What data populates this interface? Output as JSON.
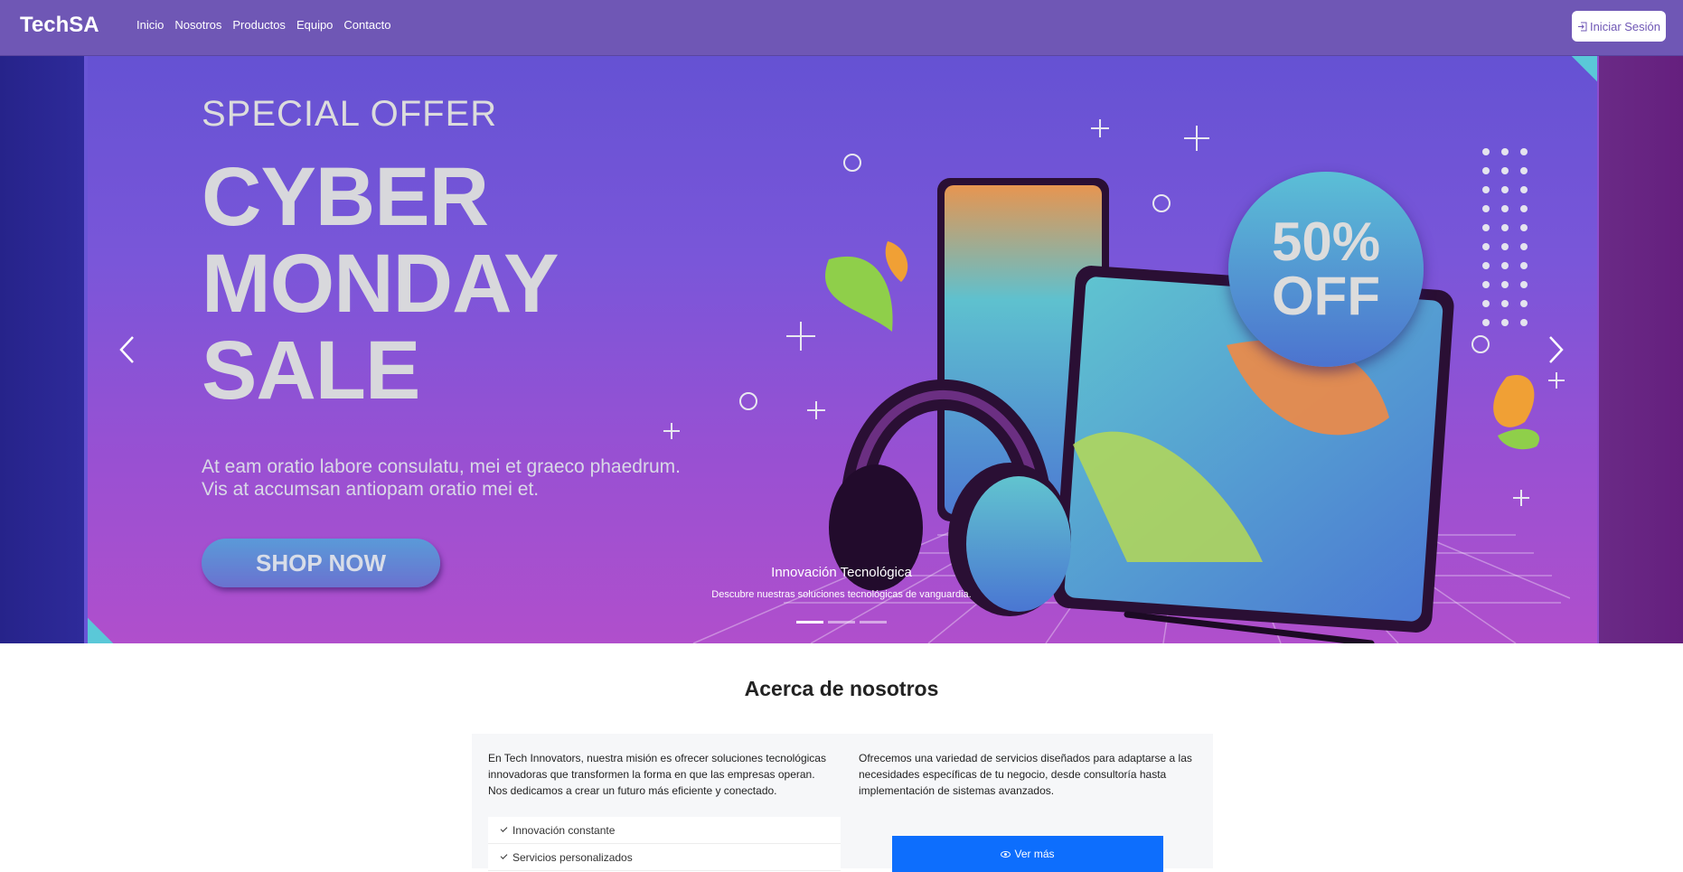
{
  "navbar": {
    "brand": "TechSA",
    "links": [
      "Inicio",
      "Nosotros",
      "Productos",
      "Equipo",
      "Contacto"
    ],
    "login_label": "Iniciar Sesión",
    "login_icon": "box-arrow-in-right-icon"
  },
  "hero": {
    "special_offer": "SPECIAL OFFER",
    "headline": [
      "CYBER",
      "MONDAY",
      "SALE"
    ],
    "subtext": "At eam oratio labore consulatu, mei et graeco phaedrum. Vis at accumsan antiopam oratio mei et.",
    "cta": "SHOP NOW",
    "badge_line1": "50%",
    "badge_line2": "OFF",
    "caption_title": "Innovación Tecnológica",
    "caption_text": "Descubre nuestras soluciones tecnológicas de vanguardia.",
    "slides_count": 3,
    "active_slide": 0,
    "prev_icon": "chevron-left-icon",
    "next_icon": "chevron-right-icon"
  },
  "about": {
    "title": "Acerca de nosotros",
    "paragraph1": "En Tech Innovators, nuestra misión es ofrecer soluciones tecnológicas innovadoras que transformen la forma en que las empresas operan. Nos dedicamos a crear un futuro más eficiente y conectado.",
    "paragraph2": "Ofrecemos una variedad de servicios diseñados para adaptarse a las necesidades específicas de tu negocio, desde consultoría hasta implementación de sistemas avanzados.",
    "list": [
      "Innovación constante",
      "Servicios personalizados"
    ],
    "more_button": "Ver más",
    "more_icon": "eye-icon"
  },
  "colors": {
    "navbar": "#6f57b5",
    "primary_button": "#0d6efd",
    "banner_badge": "#5bbfd6"
  }
}
